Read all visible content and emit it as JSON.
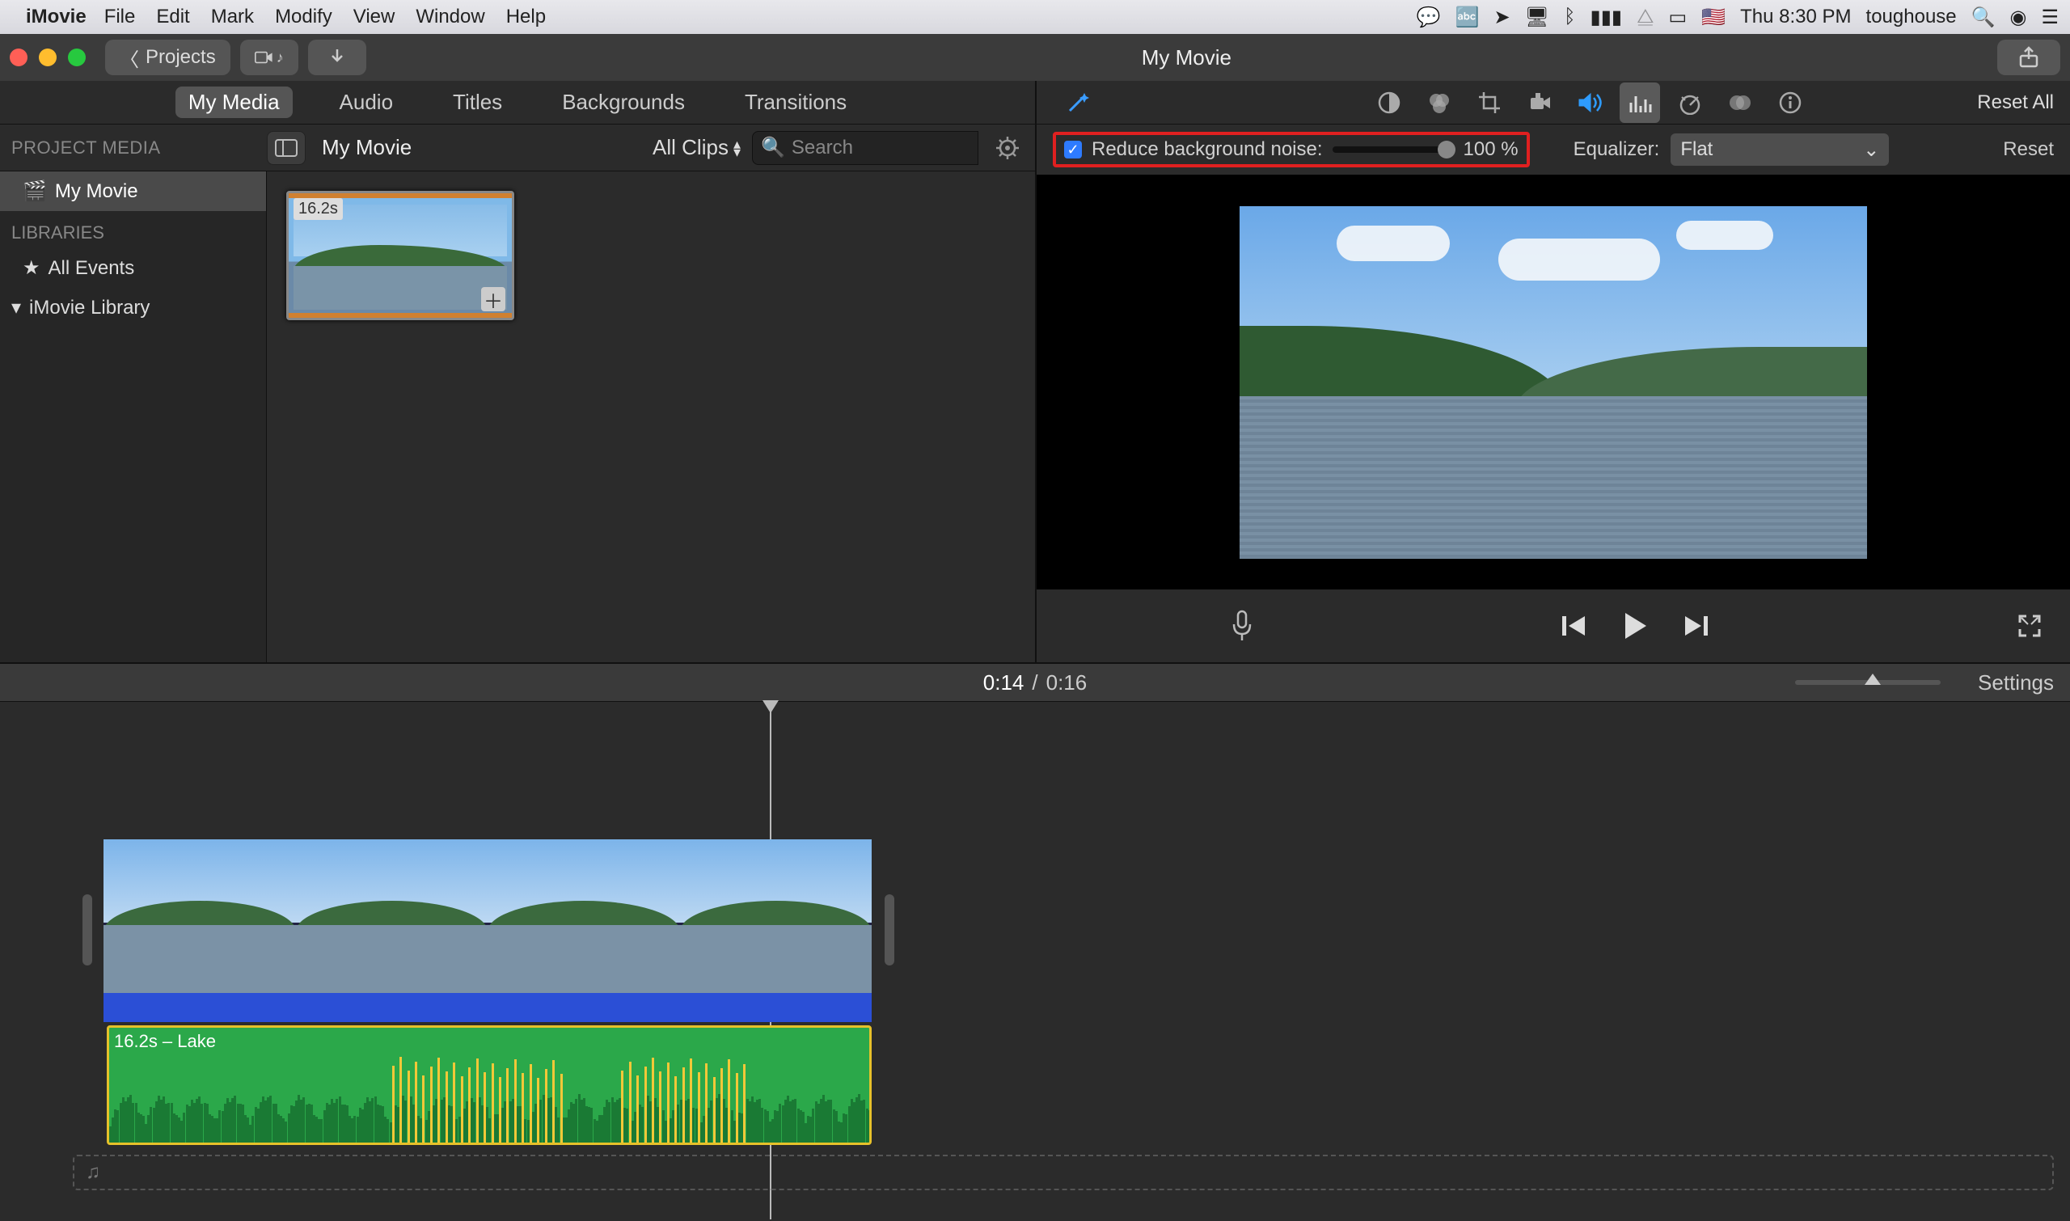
{
  "menubar": {
    "apple": "",
    "app_name": "iMovie",
    "items": [
      "File",
      "Edit",
      "Mark",
      "Modify",
      "View",
      "Window",
      "Help"
    ],
    "clock": "Thu 8:30 PM",
    "user": "toughouse"
  },
  "titlebar": {
    "back_label": "Projects",
    "title": "My Movie"
  },
  "tabs": [
    "My Media",
    "Audio",
    "Titles",
    "Backgrounds",
    "Transitions"
  ],
  "browser": {
    "project_media_label": "PROJECT MEDIA",
    "header_title": "My Movie",
    "all_clips": "All Clips",
    "search_placeholder": "Search",
    "libraries_label": "LIBRARIES",
    "sidebar": {
      "project": "My Movie",
      "all_events": "All Events",
      "library": "iMovie Library"
    },
    "clip_duration": "16.2s"
  },
  "adjust": {
    "reset_all": "Reset All",
    "noise_label": "Reduce background noise:",
    "noise_checked": true,
    "noise_value": "100 %",
    "eq_label": "Equalizer:",
    "eq_value": "Flat",
    "reset": "Reset"
  },
  "transport": {},
  "timeline": {
    "position": "0:14",
    "duration": "0:16",
    "settings": "Settings",
    "audio_clip_label": "16.2s – Lake"
  }
}
